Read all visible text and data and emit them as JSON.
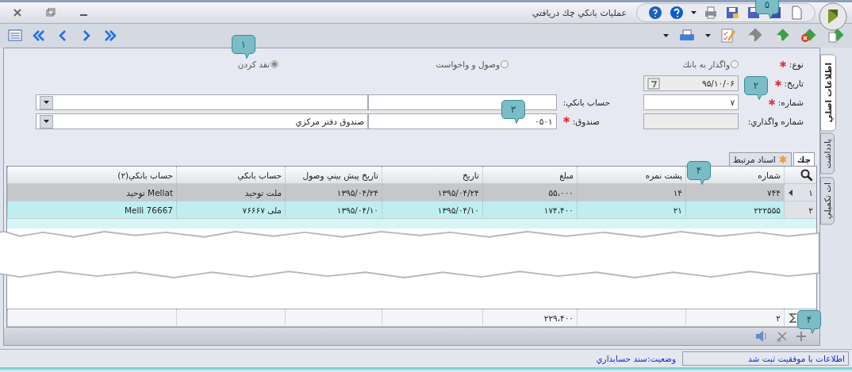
{
  "window": {
    "title": "عمليات بانكي چك دريافتي"
  },
  "form": {
    "type": {
      "label": "نوع:",
      "required": true,
      "options": [
        {
          "label": "واگذار به بانك",
          "selected": false
        },
        {
          "label": "وصول و واخواست",
          "selected": false
        },
        {
          "label": "نقد كردن",
          "selected": true
        }
      ]
    },
    "date": {
      "label": "تاريخ:",
      "value": "۹۵/۱۰/۰۶",
      "required": true,
      "disabled": true
    },
    "number": {
      "label": "شماره:",
      "value": "۷",
      "required": true,
      "disabled": false
    },
    "transfer_number": {
      "label": "شماره واگذاري:",
      "required": false,
      "disabled": true
    },
    "bank_account": {
      "label": "حساب بانكي:",
      "required": false
    },
    "cash_box": {
      "label": "صندوق:",
      "required": true,
      "code": "۰۵۰۱",
      "value": "صندوق دفتر مرکزي"
    }
  },
  "side_tabs": [
    {
      "label": "اطلاعات اصلي",
      "selected": true
    },
    {
      "label": "يادداشت",
      "selected": false
    },
    {
      "label": "ات تكميلي",
      "selected": false
    }
  ],
  "sub_tabs": [
    {
      "label": "چك",
      "selected": true
    },
    {
      "label": "اسناد مرتبط",
      "selected": false
    }
  ],
  "table": {
    "columns": [
      "شماره",
      "پشت نمره",
      "مبلغ",
      "تاريخ",
      "تاريخ پيش بيني وصول",
      "حساب بانكي",
      "حساب بانكي(۲)"
    ],
    "rows": [
      {
        "row_number": "۱",
        "selected": true,
        "cells": [
          "۷۴۴",
          "۱۴",
          "۵۵،۰۰۰",
          "۱۳۹۵/۰۴/۲۴",
          "۱۳۹۵/۰۴/۲۴",
          "ملت توحيد",
          "Mellat توحيد"
        ]
      },
      {
        "row_number": "۲",
        "selected": false,
        "cells": [
          "۲۲۲۵۵۵",
          "۲۱",
          "۱۷۴،۴۰۰",
          "۱۳۹۵/۰۴/۱۰",
          "۱۳۹۵/۰۴/۱۰",
          "ملی ۷۶۶۶۷",
          "Melli 76667"
        ]
      }
    ],
    "totals": {
      "count": "۲",
      "amount": "۲۲۹،۴۰۰"
    }
  },
  "status_bar": {
    "message": "اطلاعات با موفقيت ثبت شد",
    "status": "وضعيت:سند حسابداري"
  },
  "callouts": [
    {
      "label": "۱"
    },
    {
      "label": "۵"
    },
    {
      "label": "۲"
    },
    {
      "label": "۳"
    },
    {
      "label": "۴"
    },
    {
      "label": "۴"
    }
  ]
}
